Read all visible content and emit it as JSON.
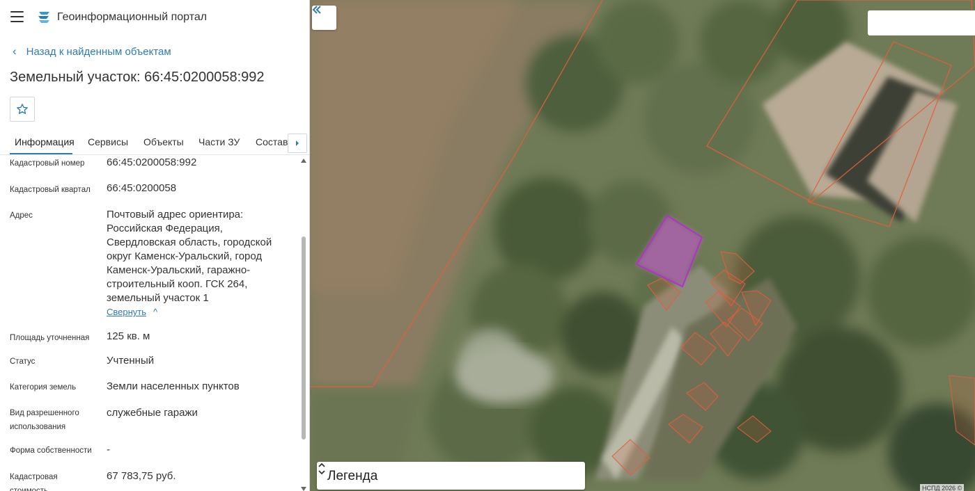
{
  "app": {
    "title": "Геоинформационный портал"
  },
  "nav": {
    "back_label": "Назад к найденным объектам"
  },
  "page": {
    "title": "Земельный участок: 66:45:0200058:992"
  },
  "tabs": [
    {
      "label": "Информация",
      "active": true
    },
    {
      "label": "Сервисы"
    },
    {
      "label": "Объекты"
    },
    {
      "label": "Части ЗУ"
    },
    {
      "label": "Состав"
    }
  ],
  "fields": [
    {
      "label": "Кадастровый номер",
      "value": "66:45:0200058:992"
    },
    {
      "label": "Кадастровый квартал",
      "value": "66:45:0200058"
    },
    {
      "label": "Адрес",
      "value_lines": [
        "Почтовый адрес ориентира:",
        "Российская Федерация,",
        "Свердловская область, городской",
        "округ Каменск-Уральский, город",
        "Каменск-Уральский, гаражно-",
        "строительный кооп. ГСК 264,",
        "земельный участок 1"
      ],
      "collapse_label": "Свернуть"
    },
    {
      "label": "Площадь уточненная",
      "value": "125 кв. м"
    },
    {
      "label": "Статус",
      "value": "Учтенный"
    },
    {
      "label": "Категория земель",
      "value": "Земли населенных пунктов"
    },
    {
      "label_lines": [
        "Вид разрешенного",
        "использования"
      ],
      "value": "служебные гаражи"
    },
    {
      "label": "Форма собственности",
      "value": "-"
    },
    {
      "label_lines": [
        "Кадастровая",
        "стоимость"
      ],
      "value": "67 783,75 руб."
    }
  ],
  "map": {
    "legend_label": "Легенда",
    "attribution": "НСПД 2026 ©",
    "colors": {
      "parcel_outline": "#e0603c",
      "selected_parcel": "#b033c8",
      "accent": "#2f7bb6"
    }
  },
  "icons": {
    "menu": "hamburger-icon",
    "logo": "logo-icon",
    "back": "chevron-left-icon",
    "favorite": "star-icon",
    "tabs_scroll": "caret-right-icon",
    "collapse": "double-chevron-left-icon",
    "legend_toggle": "unfold-icon"
  }
}
